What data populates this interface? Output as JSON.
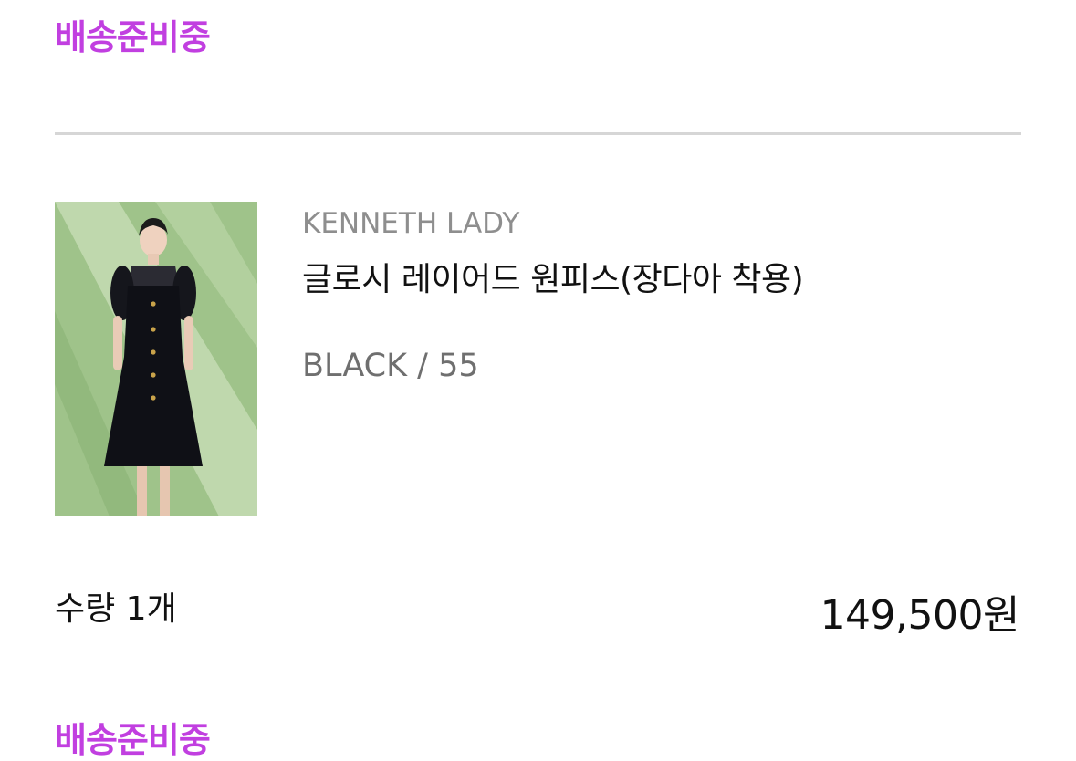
{
  "order_status_top": "배송준비중",
  "item": {
    "brand": "KENNETH LADY",
    "name": "글로시 레이어드 원피스(장다아 착용)",
    "option": "BLACK / 55",
    "quantity_label": "수량 1개",
    "price": "149,500원",
    "image_icon": "product-photo-dress"
  },
  "order_status_bottom": "배송준비중",
  "colors": {
    "status": "#c13fe0",
    "divider": "#d6d6d6",
    "brand_text": "#8e8e8e",
    "option_text": "#6f6f6f"
  }
}
